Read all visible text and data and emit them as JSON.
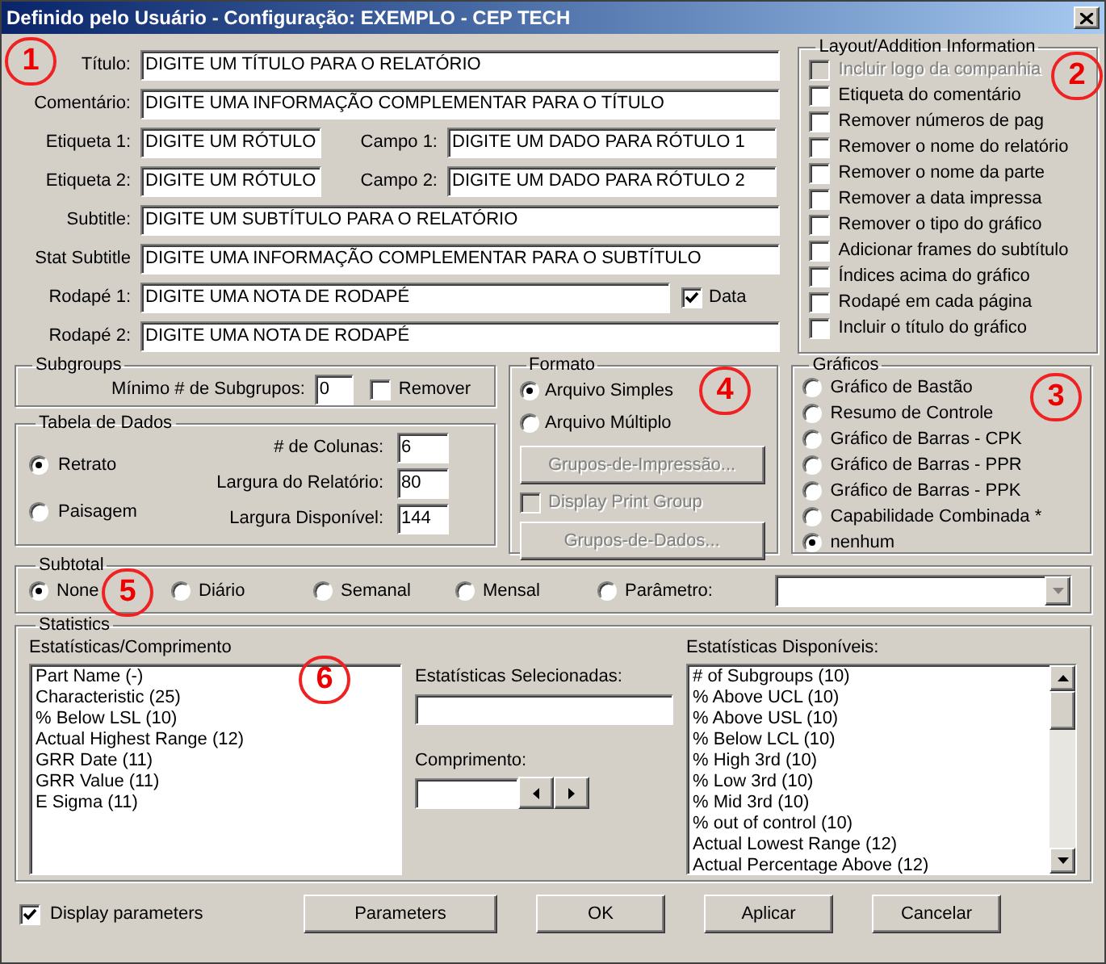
{
  "window": {
    "title": "Definido pelo Usuário - Configuração: EXEMPLO - CEP TECH"
  },
  "annotations": [
    {
      "label": "1"
    },
    {
      "label": "2"
    },
    {
      "label": "3"
    },
    {
      "label": "4"
    },
    {
      "label": "5"
    },
    {
      "label": "6"
    }
  ],
  "fields": [
    {
      "items": [
        {
          "label": "Título:",
          "value": "DIGITE UM TÍTULO PARA O RELATÓRIO"
        }
      ]
    },
    {
      "items": [
        {
          "label": "Comentário:",
          "value": "DIGITE UMA INFORMAÇÃO COMPLEMENTAR PARA O TÍTULO"
        }
      ]
    },
    {
      "items": [
        {
          "label": "Etiqueta 1:",
          "value": "DIGITE UM RÓTULO"
        },
        {
          "label": "Campo 1:",
          "value": "DIGITE UM DADO PARA RÓTULO 1"
        }
      ]
    },
    {
      "items": [
        {
          "label": "Etiqueta 2:",
          "value": "DIGITE UM RÓTULO"
        },
        {
          "label": "Campo 2:",
          "value": "DIGITE UM DADO PARA RÓTULO 2"
        }
      ]
    },
    {
      "items": [
        {
          "label": "Subtitle:",
          "value": "DIGITE UM SUBTÍTULO PARA O RELATÓRIO"
        }
      ]
    },
    {
      "items": [
        {
          "label": "Stat Subtitle",
          "value": "DIGITE UMA INFORMAÇÃO COMPLEMENTAR PARA O SUBTÍTULO"
        }
      ]
    },
    {
      "items": [
        {
          "label": "Rodapé 1:",
          "value": "DIGITE UMA NOTA DE RODAPÉ"
        }
      ],
      "checkbox": {
        "label": "Data",
        "checked": true
      }
    },
    {
      "items": [
        {
          "label": "Rodapé 2:",
          "value": "DIGITE UMA NOTA DE RODAPÉ"
        }
      ]
    }
  ],
  "layout_info": {
    "title": "Layout/Addition Information",
    "options": [
      {
        "label": "Incluir logo da companhia",
        "checked": false,
        "disabled": true
      },
      {
        "label": "Etiqueta do comentário",
        "checked": false,
        "disabled": false
      },
      {
        "label": "Remover números de pag",
        "checked": false,
        "disabled": false
      },
      {
        "label": "Remover o nome do relatório",
        "checked": false,
        "disabled": false
      },
      {
        "label": "Remover o nome da parte",
        "checked": false,
        "disabled": false
      },
      {
        "label": "Remover a data impressa",
        "checked": false,
        "disabled": false
      },
      {
        "label": "Remover o tipo do gráfico",
        "checked": false,
        "disabled": false
      },
      {
        "label": "Adicionar frames do subtítulo",
        "checked": false,
        "disabled": false
      },
      {
        "label": "Índices acima do gráfico",
        "checked": false,
        "disabled": false
      },
      {
        "label": "Rodapé em cada página",
        "checked": false,
        "disabled": false
      },
      {
        "label": "Incluir o título do gráfico",
        "checked": false,
        "disabled": false
      }
    ]
  },
  "subgroups": {
    "title": "Subgroups",
    "label": "Mínimo # de Subgrupos:",
    "value": "0",
    "checkbox": {
      "label": "Remover",
      "checked": false
    }
  },
  "data_table": {
    "title": "Tabela de Dados",
    "orientations": [
      {
        "label": "Retrato",
        "selected": true
      },
      {
        "label": "Paisagem",
        "selected": false
      }
    ],
    "fields": [
      {
        "label": "# de Colunas:",
        "value": "6"
      },
      {
        "label": "Largura do Relatório:",
        "value": "80"
      },
      {
        "label": "Largura Disponível:",
        "value": "144"
      }
    ]
  },
  "format": {
    "title": "Formato",
    "options": [
      {
        "label": "Arquivo  Simples",
        "selected": true
      },
      {
        "label": "Arquivo  Múltiplo",
        "selected": false
      }
    ],
    "controls": [
      {
        "kind": "button",
        "label": "Grupos-de-Impressão...",
        "disabled": true
      },
      {
        "kind": "checkbox",
        "label": "Display Print Group",
        "checked": false,
        "disabled": true
      },
      {
        "kind": "button",
        "label": "Grupos-de-Dados...",
        "disabled": true
      }
    ]
  },
  "charts": {
    "title": "Gráficos",
    "options": [
      {
        "label": "Gráfico de Bastão",
        "selected": false
      },
      {
        "label": "Resumo de Controle",
        "selected": false
      },
      {
        "label": "Gráfico de Barras - CPK",
        "selected": false
      },
      {
        "label": "Gráfico de Barras - PPR",
        "selected": false
      },
      {
        "label": "Gráfico de Barras - PPK",
        "selected": false
      },
      {
        "label": "Capabilidade Combinada *",
        "selected": false
      },
      {
        "label": "nenhum",
        "selected": true
      }
    ]
  },
  "subtotal": {
    "title": "Subtotal",
    "options": [
      {
        "label": "None",
        "selected": true
      },
      {
        "label": "Diário",
        "selected": false
      },
      {
        "label": "Semanal",
        "selected": false
      },
      {
        "label": "Mensal",
        "selected": false
      },
      {
        "label": "Parâmetro:",
        "selected": false
      }
    ],
    "dropdown": {
      "disabled": true
    }
  },
  "statistics": {
    "title": "Statistics",
    "list_title": "Estatísticas/Comprimento",
    "list_items": [
      "Part Name (-)",
      "Characteristic (25)",
      "% Below LSL (10)",
      "Actual Highest Range (12)",
      "GRR Date (11)",
      "GRR Value (11)",
      "E Sigma (11)"
    ],
    "selected_label": "Estatísticas Selecionadas:",
    "length_label": "Comprimento:",
    "available_title": "Estatísticas Disponíveis:",
    "available_items": [
      "# of Subgroups (10)",
      "% Above UCL (10)",
      "% Above USL (10)",
      "% Below LCL (10)",
      "% High 3rd (10)",
      "% Low 3rd (10)",
      "% Mid 3rd (10)",
      "% out of control (10)",
      "Actual Lowest Range (12)",
      "Actual Percentage Above (12)"
    ]
  },
  "footer": {
    "checkbox": {
      "label": "Display parameters",
      "checked": true
    },
    "buttons": [
      "Parameters",
      "OK",
      "Aplicar",
      "Cancelar"
    ]
  }
}
